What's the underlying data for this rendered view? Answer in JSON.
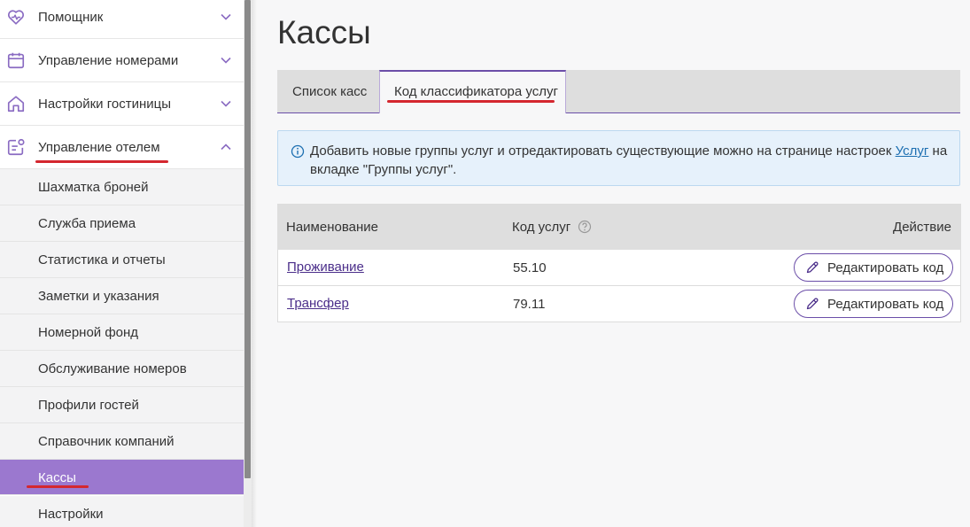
{
  "sidebar": {
    "items": [
      {
        "label": "Помощник",
        "icon": "heart-pulse-icon"
      },
      {
        "label": "Управление номерами",
        "icon": "calendar-icon"
      },
      {
        "label": "Настройки гостиницы",
        "icon": "house-icon"
      },
      {
        "label": "Управление отелем",
        "icon": "hotel-manage-icon"
      }
    ],
    "sub_items": [
      "Шахматка броней",
      "Служба приема",
      "Статистика и отчеты",
      "Заметки и указания",
      "Номерной фонд",
      "Обслуживание номеров",
      "Профили гостей",
      "Справочник компаний",
      "Кассы",
      "Настройки"
    ],
    "selected_sub": "Кассы"
  },
  "page": {
    "title": "Кассы"
  },
  "tabs": [
    {
      "label": "Список касс"
    },
    {
      "label": "Код классификатора услуг",
      "active": true
    }
  ],
  "info": {
    "text_before": "Добавить новые группы услуг и отредактировать существующие можно на странице настроек ",
    "link": "Услуг",
    "text_after": " на вкладке \"Группы услуг\"."
  },
  "table": {
    "headers": {
      "name": "Наименование",
      "code": "Код услуг",
      "action": "Действие"
    },
    "rows": [
      {
        "name": "Проживание",
        "code": "55.10",
        "action": "Редактировать код"
      },
      {
        "name": "Трансфер",
        "code": "79.11",
        "action": "Редактировать код"
      }
    ]
  },
  "colors": {
    "accent": "#6b4ea8",
    "selected_bg": "#9b78cf",
    "annotation_red": "#d4272f",
    "info_bg": "#e6f1fb"
  }
}
